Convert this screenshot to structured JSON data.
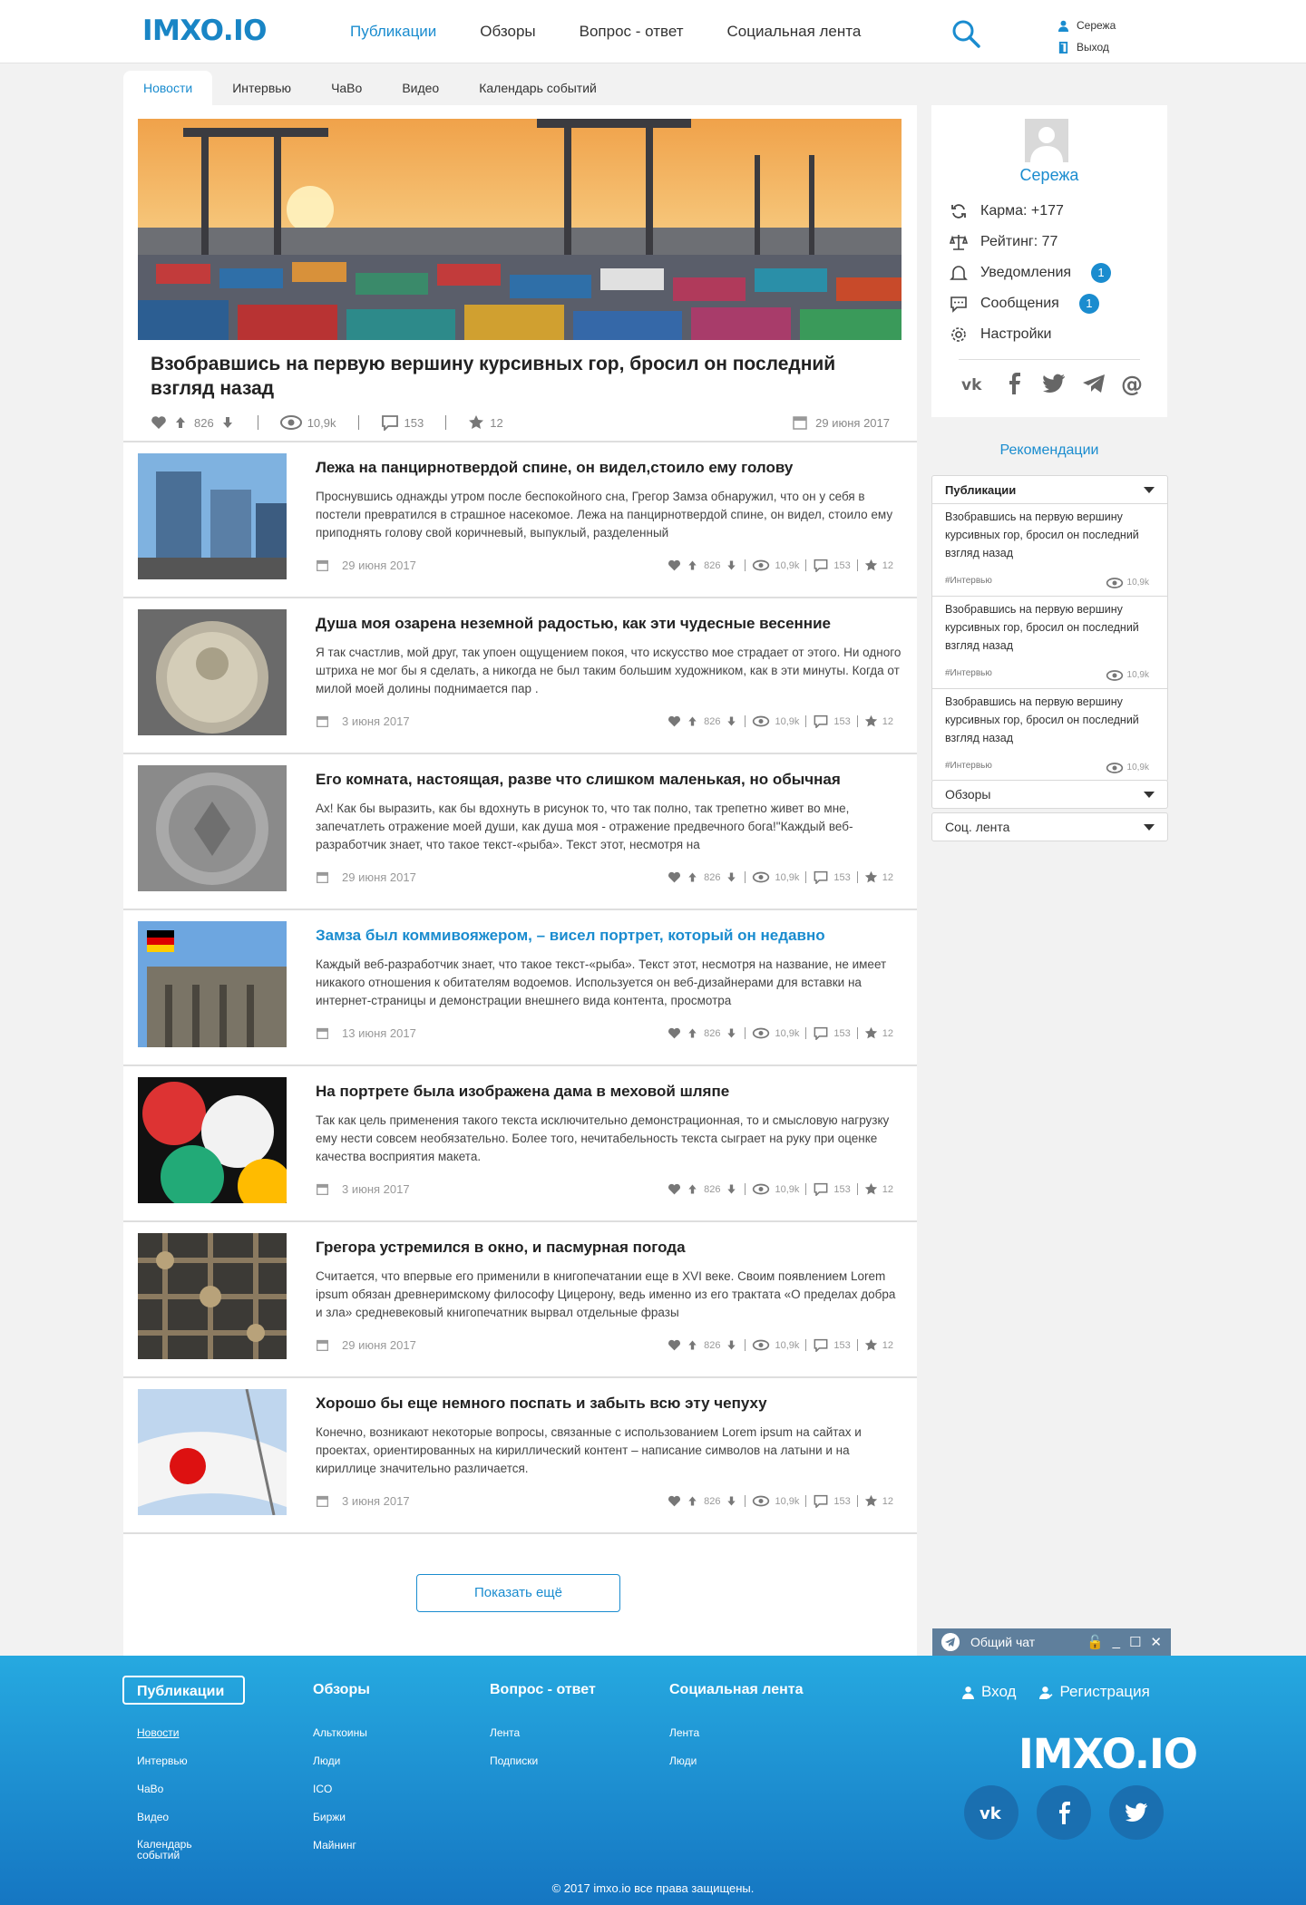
{
  "header": {
    "logo": "IMXO.IO",
    "nav": [
      "Публикации",
      "Обзоры",
      "Вопрос - ответ",
      "Социальная лента"
    ],
    "user": "Сережа",
    "logout": "Выход"
  },
  "tabs": [
    "Новости",
    "Интервью",
    "ЧаВо",
    "Видео",
    "Календарь событий"
  ],
  "hero": {
    "title": "Взобравшись на первую вершину курсивных гор, бросил он последний взгляд назад",
    "likes": "826",
    "views": "10,9k",
    "comments": "153",
    "stars": "12",
    "date": "29 июня 2017"
  },
  "articles": [
    {
      "title": "Лежа на панцирнотвердой спине, он видел,стоило ему голову",
      "text": "Проснувшись однажды утром после беспокойного сна, Грегор Замза обнаружил, что он у себя в постели превратился в страшное насекомое. Лежа на панцирнотвердой спине, он видел, стоило ему приподнять голову свой коричневый, выпуклый, разделенный",
      "date": "29 июня 2017",
      "likes": "826",
      "views": "10,9k",
      "comments": "153",
      "stars": "12"
    },
    {
      "title": "Душа моя озарена неземной радостью, как эти чудесные весенние",
      "text": "Я так счастлив, мой друг, так упоен ощущением покоя, что искусство мое страдает от этого. Ни одного штриха не мог бы я сделать, а никогда не был таким большим художником, как в эти минуты. Когда от милой моей долины поднимается пар .",
      "date": "3 июня 2017",
      "likes": "826",
      "views": "10,9k",
      "comments": "153",
      "stars": "12"
    },
    {
      "title": "Его комната, настоящая, разве что слишком маленькая, но обычная",
      "text": "Ах! Как бы выразить, как бы вдохнуть в рисунок то, что так полно, так трепетно живет во мне, запечатлеть отражение моей души, как душа моя - отражение предвечного бога!\"Каждый веб-разработчик знает, что такое текст-«рыба». Текст этот, несмотря на",
      "date": "29 июня 2017",
      "likes": "826",
      "views": "10,9k",
      "comments": "153",
      "stars": "12"
    },
    {
      "title": "Замза был коммивояжером, – висел портрет, который он недавно",
      "text": "Каждый веб-разработчик знает, что такое текст-«рыба». Текст этот, несмотря на название, не имеет никакого отношения к обитателям водоемов. Используется он веб-дизайнерами для вставки на интернет-страницы и демонстрации внешнего вида контента, просмотра",
      "date": "13 июня 2017",
      "likes": "826",
      "views": "10,9k",
      "comments": "153",
      "stars": "12"
    },
    {
      "title": "На портрете была изображена дама в меховой шляпе",
      "text": "Так как цель применения такого текста исключительно демонстрационная, то и смысловую нагрузку ему нести совсем необязательно. Более того, нечитабельность текста сыграет на руку при оценке качества восприятия макета.",
      "date": "3 июня 2017",
      "likes": "826",
      "views": "10,9k",
      "comments": "153",
      "stars": "12"
    },
    {
      "title": "Грегора устремился в окно, и пасмурная погода",
      "text": "Считается, что впервые его применили в книгопечатании еще в XVI веке. Своим появлением Lorem ipsum обязан древнеримскому философу Цицерону, ведь именно из его трактата «О пределах добра и зла» средневековый книгопечатник вырвал отдельные фразы",
      "date": "29 июня 2017",
      "likes": "826",
      "views": "10,9k",
      "comments": "153",
      "stars": "12"
    },
    {
      "title": "Хорошо бы еще немного поспать и забыть всю эту чепуху",
      "text": "Конечно, возникают некоторые вопросы, связанные с использованием Lorem ipsum на сайтах и проектах, ориентированных на кириллический контент – написание символов на латыни и на кириллице значительно различается.",
      "date": "3 июня 2017",
      "likes": "826",
      "views": "10,9k",
      "comments": "153",
      "stars": "12"
    }
  ],
  "more_button": "Показать ещё",
  "profile": {
    "name": "Сережа",
    "karma": "Карма: +177",
    "rating": "Рейтинг: 77",
    "notifications": "Уведомления",
    "notifications_count": "1",
    "messages": "Сообщения",
    "messages_count": "1",
    "settings": "Настройки"
  },
  "recommendations": {
    "title": "Рекомендации",
    "section": "Публикации",
    "items": [
      {
        "text": "Взобравшись на первую вершину курсивных гор, бросил он последний взгляд назад",
        "tag": "#Интервью",
        "views": "10,9k"
      },
      {
        "text": "Взобравшись на первую вершину курсивных гор, бросил он последний взгляд назад",
        "tag": "#Интервью",
        "views": "10,9k"
      },
      {
        "text": "Взобравшись на первую вершину курсивных гор, бросил он последний взгляд назад",
        "tag": "#Интервью",
        "views": "10,9k"
      }
    ],
    "dropdown_reviews": "Обзоры",
    "dropdown_social": "Соц. лента"
  },
  "chat": {
    "label": "Общий чат"
  },
  "footer": {
    "col1": {
      "head": "Публикации",
      "links": [
        "Новости",
        "Интервью",
        "ЧаВо",
        "Видео",
        "Календарь событий"
      ]
    },
    "col2": {
      "head": "Обзоры",
      "links": [
        "Альткоины",
        "Люди",
        "ICO",
        "Биржи",
        "Майнинг"
      ]
    },
    "col3": {
      "head": "Вопрос - ответ",
      "links": [
        "Лента",
        "Подписки"
      ]
    },
    "col4": {
      "head": "Социальная лента",
      "links": [
        "Лента",
        "Люди"
      ]
    },
    "login": "Вход",
    "register": "Регистрация",
    "logo": "IMXO.IO",
    "copyright": "© 2017 imxo.io все права защищены."
  },
  "colors": {
    "accent": "#1a8ccf",
    "footer_top": "#26a9e0",
    "footer_bottom": "#1576c2"
  }
}
